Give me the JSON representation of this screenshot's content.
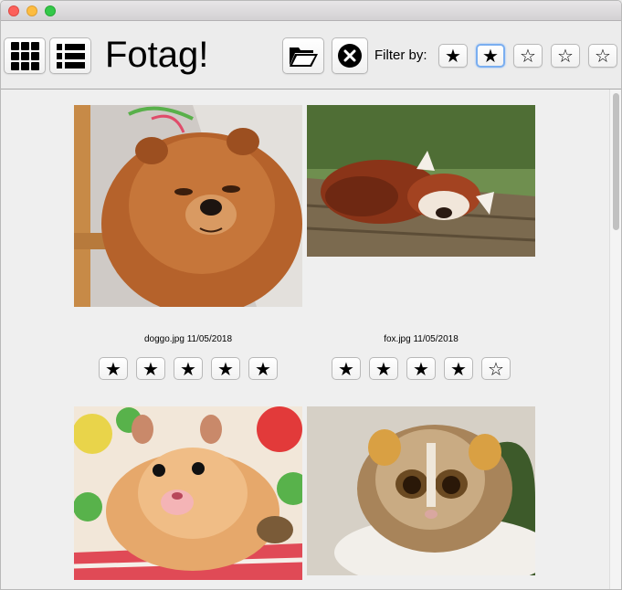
{
  "app": {
    "title": "Fotag!"
  },
  "toolbar": {
    "grid_view_icon": "grid-icon",
    "list_view_icon": "list-icon",
    "open_icon": "folder-open-icon",
    "clear_icon": "clear-x-icon",
    "filter_label": "Filter by:",
    "filter_stars": [
      "★",
      "★",
      "☆",
      "☆",
      "☆"
    ],
    "filter_selected_index": 1
  },
  "photos": [
    {
      "filename": "doggo.jpg",
      "date": "11/05/2018",
      "caption": "doggo.jpg  11/05/2018",
      "subject": "chow chow dog",
      "stars": [
        "★",
        "★",
        "★",
        "★",
        "★"
      ],
      "rating": 5
    },
    {
      "filename": "fox.jpg",
      "date": "11/05/2018",
      "caption": "fox.jpg  11/05/2018",
      "subject": "red panda",
      "stars": [
        "★",
        "★",
        "★",
        "★",
        "☆"
      ],
      "rating": 4
    },
    {
      "subject": "hamster"
    },
    {
      "subject": "slow loris"
    }
  ],
  "colors": {
    "selected_outline": "#7aaef0",
    "window_bg": "#ececec"
  }
}
